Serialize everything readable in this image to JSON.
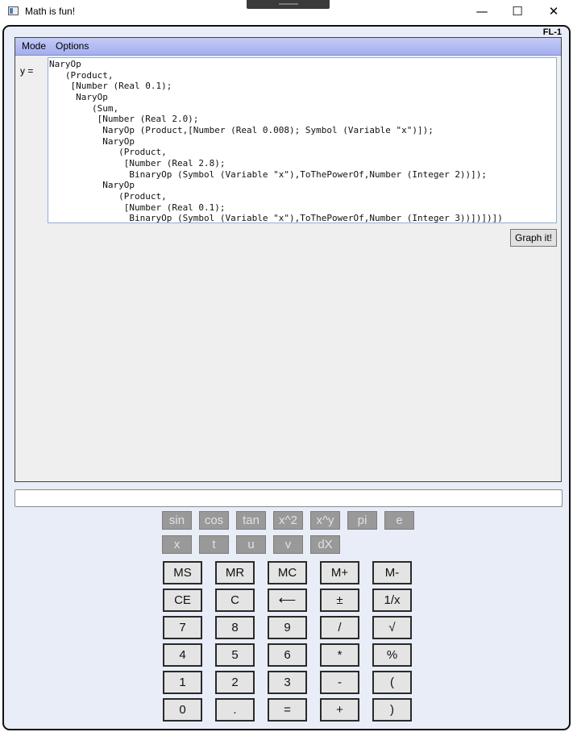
{
  "window": {
    "title": "Math is fun!",
    "minimize_glyph": "—",
    "maximize_glyph": "☐",
    "close_glyph": "✕"
  },
  "badge": "FL-1",
  "menu": {
    "items": [
      "Mode",
      "Options"
    ]
  },
  "expression": {
    "label": "y =",
    "lines": [
      "NaryOp",
      "   (Product,",
      "    [Number (Real 0.1);",
      "     NaryOp",
      "        (Sum,",
      "         [Number (Real 2.0);",
      "          NaryOp (Product,[Number (Real 0.008); Symbol (Variable \"x\")]);",
      "          NaryOp",
      "             (Product,",
      "              [Number (Real 2.8);",
      "               BinaryOp (Symbol (Variable \"x\"),ToThePowerOf,Number (Integer 2))]);",
      "          NaryOp",
      "             (Product,",
      "              [Number (Real 0.1);",
      "               BinaryOp (Symbol (Variable \"x\"),ToThePowerOf,Number (Integer 3))])])])"
    ]
  },
  "graph_button": "Graph it!",
  "display": {
    "value": ""
  },
  "function_rows": [
    [
      "sin",
      "cos",
      "tan",
      "x^2",
      "x^y",
      "pi",
      "e"
    ],
    [
      "x",
      "t",
      "u",
      "v",
      "dX"
    ]
  ],
  "keypad_rows": [
    [
      "MS",
      "MR",
      "MC",
      "M+",
      "M-"
    ],
    [
      "CE",
      "C",
      "⟵",
      "±",
      "1/x"
    ],
    [
      "7",
      "8",
      "9",
      "/",
      "√"
    ],
    [
      "4",
      "5",
      "6",
      "*",
      "%"
    ],
    [
      "1",
      "2",
      "3",
      "-",
      "("
    ],
    [
      "0",
      ".",
      "=",
      "+",
      ")"
    ]
  ],
  "colors": {
    "client_bg": "#e9edf8",
    "menubar_top": "#c4cbf6",
    "menubar_bottom": "#a3aeee",
    "function_button": "#999999",
    "key_button": "#e4e4e4"
  }
}
